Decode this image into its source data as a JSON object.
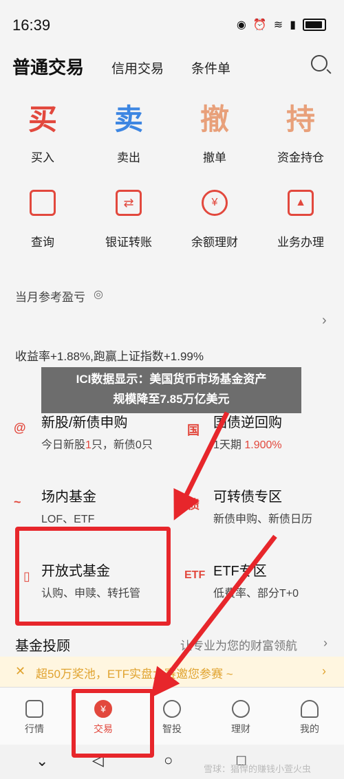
{
  "status_bar": {
    "time": "16:39",
    "icons": [
      "eye-icon",
      "alarm-icon",
      "wifi-icon",
      "signal-icon",
      "battery-icon"
    ]
  },
  "header": {
    "title": "普通交易",
    "tabs": [
      "信用交易",
      "条件单"
    ]
  },
  "actions_row1": [
    {
      "char": "买",
      "label": "买入",
      "color": "#e2483d"
    },
    {
      "char": "卖",
      "label": "卖出",
      "color": "#3d86e2"
    },
    {
      "char": "撤",
      "label": "撤单",
      "color": "#e8a07a"
    },
    {
      "char": "持",
      "label": "资金持仓",
      "color": "#e8a07a"
    }
  ],
  "actions_row2": [
    {
      "icon": "query-icon",
      "label": "查询"
    },
    {
      "icon": "transfer-icon",
      "label": "银证转账"
    },
    {
      "icon": "money-bag-icon",
      "label": "余额理财"
    },
    {
      "icon": "business-icon",
      "label": "业务办理"
    }
  ],
  "profit": {
    "title": "当月参考盈亏",
    "summary": "收益率+1.88%,跑赢上证指数+1.99%"
  },
  "news": {
    "line1": "ICI数据显示：美国货币市场基金资产",
    "line2": "规模降至7.85万亿美元"
  },
  "services": [
    {
      "title": "新股/新债申购",
      "sub_a": "今日新股",
      "sub_num": "1",
      "sub_b": "只，新债0只",
      "icon": "@"
    },
    {
      "title": "国债逆回购",
      "sub_a": "1天期 ",
      "sub_num": "1.900%",
      "sub_b": "",
      "icon": "国"
    },
    {
      "title": "场内基金",
      "sub_a": "LOF、ETF",
      "sub_num": "",
      "sub_b": "",
      "icon": "~"
    },
    {
      "title": "可转债专区",
      "sub_a": "新债申购、新债日历",
      "sub_num": "",
      "sub_b": "",
      "icon": "债"
    },
    {
      "title": "开放式基金",
      "sub_a": "认购、申赎、转托管",
      "sub_num": "",
      "sub_b": "",
      "icon": "▯"
    },
    {
      "title": "ETF专区",
      "sub_a": "低费率、部分T+0",
      "sub_num": "",
      "sub_b": "",
      "icon": "ETF"
    }
  ],
  "advisor": {
    "title": "基金投顾",
    "desc": "让专业为您的财富领航"
  },
  "promo": {
    "text": "超50万奖池，ETF实盘大赛邀您参赛 ~"
  },
  "tabbar": [
    {
      "label": "行情",
      "icon": "market-icon"
    },
    {
      "label": "交易",
      "icon": "yen-icon"
    },
    {
      "label": "智投",
      "icon": "smart-invest-icon"
    },
    {
      "label": "理财",
      "icon": "wealth-icon"
    },
    {
      "label": "我的",
      "icon": "user-icon"
    }
  ],
  "watermark": "雪球：猖悍的赚钱小萱火虫",
  "colors": {
    "accent": "#e2483d",
    "annotation": "#e7262b",
    "promo": "#e0a32f"
  }
}
